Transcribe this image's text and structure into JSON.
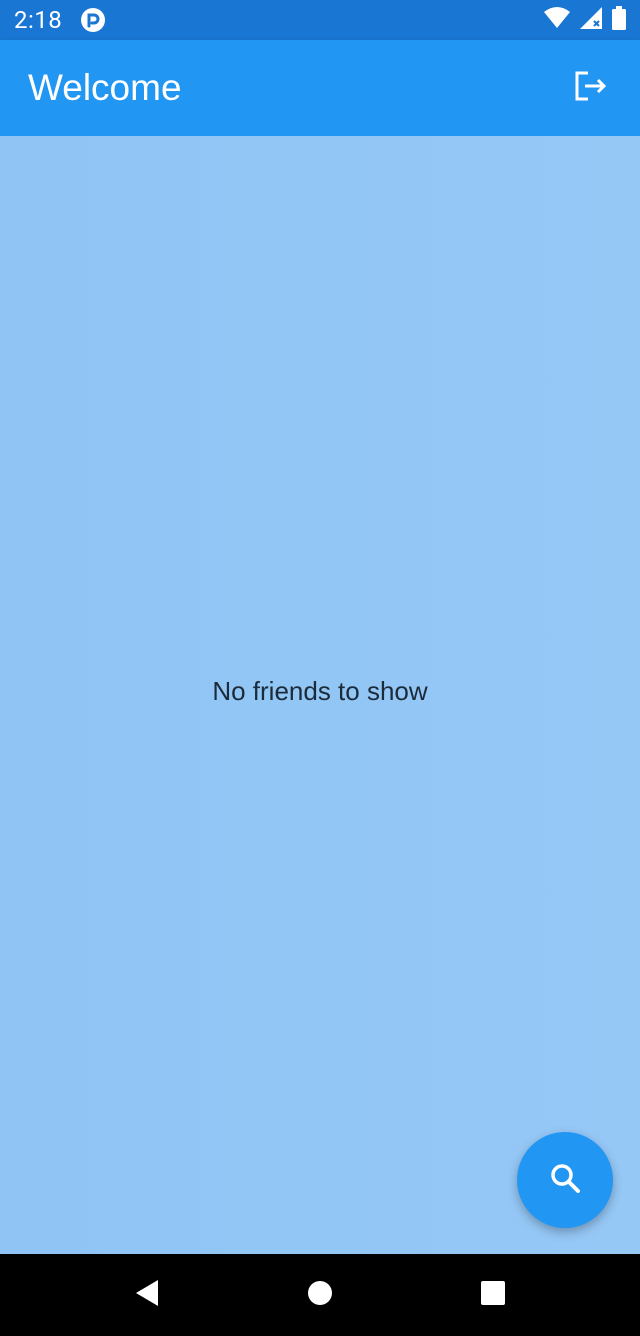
{
  "status_bar": {
    "time": "2:18",
    "icons": [
      "app-notification-icon",
      "wifi-icon",
      "signal-icon",
      "battery-icon"
    ]
  },
  "app_bar": {
    "title": "Welcome",
    "action_icon": "logout-icon"
  },
  "main": {
    "empty_message": "No friends to show"
  },
  "fab": {
    "icon": "search-icon"
  },
  "navigation": {
    "buttons": [
      "back-icon",
      "home-icon",
      "recents-icon"
    ]
  },
  "colors": {
    "status_bar": "#1976d2",
    "app_bar": "#2196f3",
    "content_background": "#92c6f5",
    "fab": "#2196f3",
    "nav_bar": "#000000"
  }
}
